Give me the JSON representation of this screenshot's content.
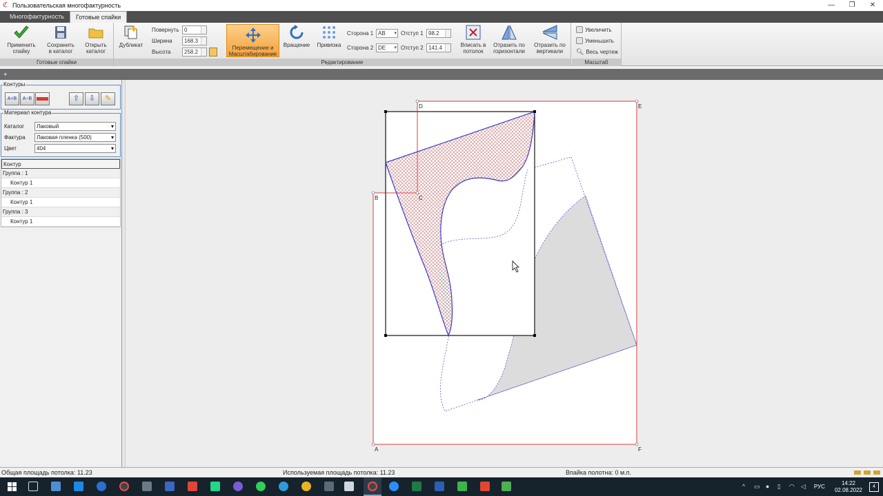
{
  "window": {
    "title": "Пользовательская многофактурность",
    "controls": {
      "minimize": "—",
      "maximize": "❐",
      "close": "✕"
    }
  },
  "ribbon_tabs": [
    {
      "label": "Многофактурность"
    },
    {
      "label": "Готовые спайки"
    }
  ],
  "ribbon": {
    "groups": {
      "ready": "Готовые спайки",
      "edit": "Редактирование",
      "scale": "Масштаб"
    },
    "apply": "Применить спайку",
    "apply_l1": "Применить",
    "apply_l2": "спайку",
    "save_l1": "Сохранить",
    "save_l2": "в каталог",
    "open_l1": "Открыть",
    "open_l2": "каталог",
    "duplicate": "Дубликат",
    "rotate_label": "Повернуть",
    "rotate_value": "0",
    "width_label": "Ширина",
    "width_value": "168.3",
    "height_label": "Высота",
    "height_value": "258.2",
    "move_l1": "Перемещение и",
    "move_l2": "Масштабирование",
    "rotation": "Вращение",
    "snap": "Привязка",
    "side1_label": "Сторона 1",
    "side1_value": "AB",
    "side2_label": "Сторона 2",
    "side2_value": "DE",
    "offset1_label": "Отступ 1",
    "offset1_value": "98.2",
    "offset2_label": "Отступ 2",
    "offset2_value": "141.4",
    "fit_l1": "Вписать в",
    "fit_l2": "потолок",
    "flip_h_l1": "Отразить по",
    "flip_h_l2": "горизонтали",
    "flip_v_l1": "Отразить по",
    "flip_v_l2": "вертикали",
    "zoom_in": "Увеличить",
    "zoom_out": "Уменьшить",
    "zoom_all": "Весь чертеж"
  },
  "left_panel": {
    "contours_title": "Контуры",
    "tool_ab_plus": "A+B",
    "tool_a_minus_b": "A−B",
    "material_title": "Материал контура",
    "catalog_label": "Каталог",
    "catalog_value": "Лаковый",
    "texture_label": "Фактура",
    "texture_value": "Лаковая пленка (500)",
    "color_label": "Цвет",
    "color_value": "404",
    "tree": [
      {
        "label": "Контур",
        "kind": "header"
      },
      {
        "label": "Группа :  1",
        "kind": "group"
      },
      {
        "label": "Контур 1",
        "kind": "child"
      },
      {
        "label": "Группа :  2",
        "kind": "group"
      },
      {
        "label": "Контур 1",
        "kind": "child"
      },
      {
        "label": "Группа :  3",
        "kind": "group"
      },
      {
        "label": "Контур 1",
        "kind": "child"
      }
    ]
  },
  "canvas": {
    "points": {
      "A": "A",
      "B": "B",
      "C": "C",
      "D": "D",
      "E": "E",
      "F": "F"
    },
    "colors": {
      "outline": "#e03c3c",
      "selection": "#000000",
      "contour": "#3b3bcc",
      "hatch": "#c97a7a",
      "fill": "#dcdcdc"
    }
  },
  "status": {
    "total_area": "Общая площадь потолка: 11.23",
    "used_area": "Используемая площадь потолка: 11.23",
    "insert": "Впайка полотна: 0 м.п."
  },
  "taskbar": {
    "lang": "РУС",
    "time": "14:22",
    "date": "02.08.2022",
    "notifications": "4"
  }
}
